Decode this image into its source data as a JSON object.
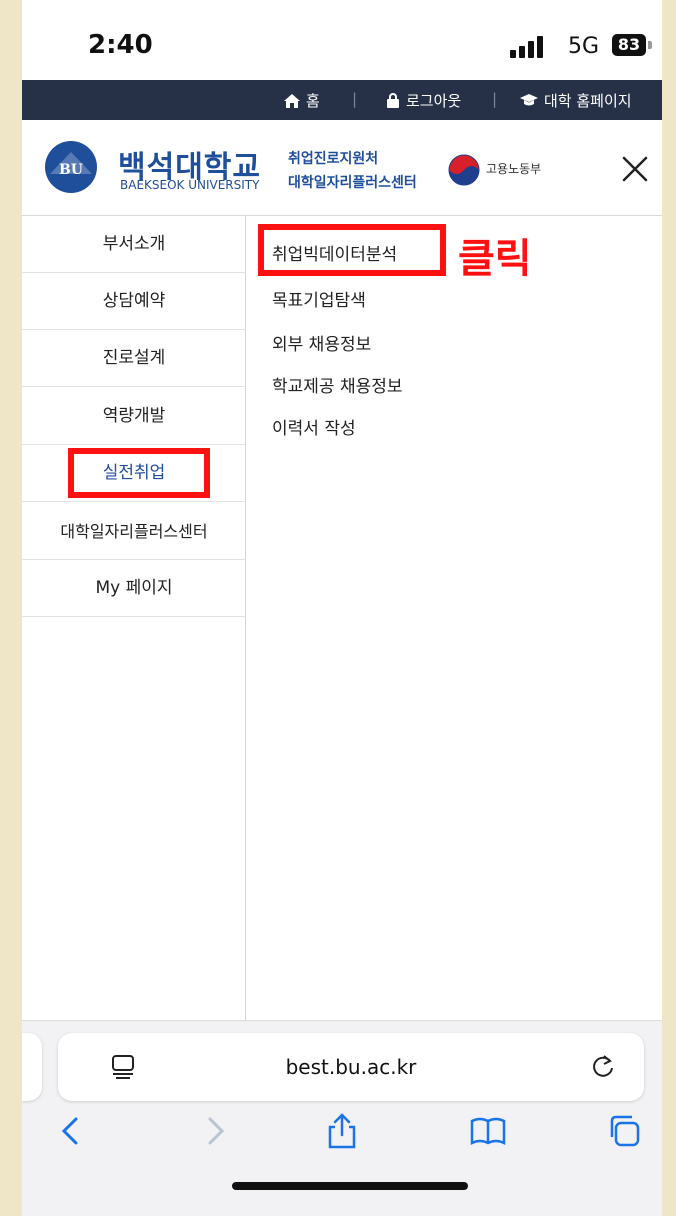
{
  "status": {
    "time": "2:40",
    "network": "5G",
    "battery": "83"
  },
  "util": {
    "home": "홈",
    "logout": "로그아웃",
    "univ_home": "대학 홈페이지",
    "sep": "|"
  },
  "header": {
    "logo_kr": "백석대학교",
    "logo_en": "BAEKSEOK UNIVERSITY",
    "logo_badge": "BU",
    "center_line1": "취업진로지원처",
    "center_line2": "대학일자리플러스센터",
    "moel": "고용노동부"
  },
  "leftnav": {
    "items": [
      {
        "label": "부서소개"
      },
      {
        "label": "상담예약"
      },
      {
        "label": "진로설계"
      },
      {
        "label": "역량개발"
      },
      {
        "label": "실전취업"
      },
      {
        "label": "대학일자리플러스센터"
      },
      {
        "label": "My 페이지"
      }
    ]
  },
  "submenu": {
    "items": [
      {
        "label": "취업빅데이터분석"
      },
      {
        "label": "목표기업탐색"
      },
      {
        "label": "외부 채용정보"
      },
      {
        "label": "학교제공 채용정보"
      },
      {
        "label": "이력서 작성"
      }
    ]
  },
  "annotation": {
    "click_label": "클릭",
    "color": "#ff1111"
  },
  "browser": {
    "url": "best.bu.ac.kr"
  },
  "colors": {
    "brand": "#1f4e9b",
    "util_bg": "#263148"
  }
}
